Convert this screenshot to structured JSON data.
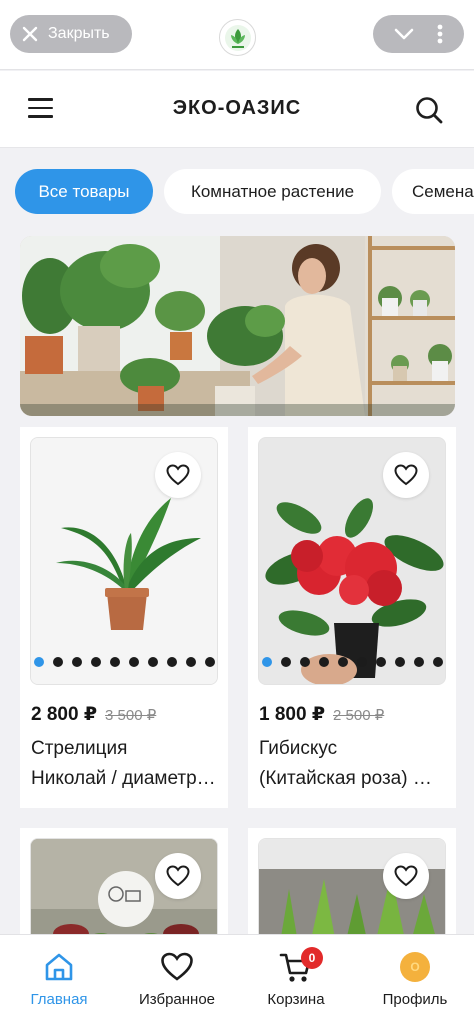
{
  "topbar": {
    "close_label": "Закрыть",
    "logo_text": "Eco-Friendly"
  },
  "header": {
    "brand": "ЭКО-ОАЗИС"
  },
  "categories": [
    {
      "label": "Все товары",
      "active": true
    },
    {
      "label": "Комнатное растение",
      "active": false
    },
    {
      "label": "Семена",
      "active": false
    }
  ],
  "products": [
    {
      "price": "2 800 ₽",
      "old_price": "3 500 ₽",
      "title_line1": "Стрелиция",
      "title_line2": "Николай / диаметр…",
      "photos_count": 10,
      "active_photo": 1
    },
    {
      "price": "1 800 ₽",
      "old_price": "2 500 ₽",
      "title_line1": "Гибискус",
      "title_line2": "(Китайская роза) …",
      "photos_count": 10,
      "active_photo": 1
    }
  ],
  "bottom_nav": [
    {
      "label": "Главная",
      "icon": "home-icon",
      "active": true
    },
    {
      "label": "Избранное",
      "icon": "heart-icon",
      "active": false
    },
    {
      "label": "Корзина",
      "icon": "cart-icon",
      "active": false,
      "badge": "0"
    },
    {
      "label": "Профиль",
      "icon": "avatar",
      "active": false,
      "avatar_letter": "О"
    }
  ],
  "colors": {
    "accent": "#2f95e8",
    "badge": "#e22a2a",
    "avatar": "#f4b13d"
  }
}
